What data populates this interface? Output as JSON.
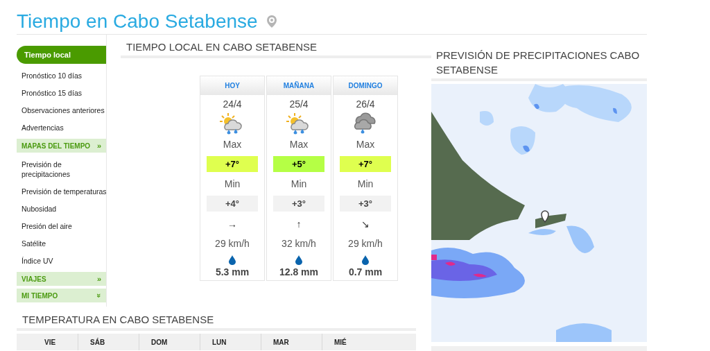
{
  "title": "Tiempo en Cabo Setabense",
  "sidebar": {
    "items": [
      {
        "kind": "link",
        "label": "Tiempo local",
        "selected": true
      },
      {
        "kind": "link",
        "label": "Pronóstico 10 días",
        "selected": false
      },
      {
        "kind": "link",
        "label": "Pronóstico 15 días",
        "selected": false
      },
      {
        "kind": "link",
        "label": "Observaciones anteriores",
        "selected": false
      },
      {
        "kind": "link",
        "label": "Advertencias",
        "selected": false
      },
      {
        "kind": "section",
        "label": "MAPAS DEL TIEMPO",
        "arrow": "»",
        "expanded": false
      },
      {
        "kind": "link",
        "label": "Previsión de precipitaciones",
        "selected": false
      },
      {
        "kind": "link",
        "label": "Previsión de temperaturas",
        "selected": false
      },
      {
        "kind": "link",
        "label": "Nubosidad",
        "selected": false
      },
      {
        "kind": "link",
        "label": "Presión del aire",
        "selected": false
      },
      {
        "kind": "link",
        "label": "Satélite",
        "selected": false
      },
      {
        "kind": "link",
        "label": "Índice UV",
        "selected": false
      },
      {
        "kind": "section",
        "label": "VIAJES",
        "arrow": "»",
        "expanded": false
      },
      {
        "kind": "section",
        "label": "MI TIEMPO",
        "arrow": "»",
        "expanded": true
      }
    ]
  },
  "forecast": {
    "heading": "TIEMPO LOCAL EN CABO SETABENSE",
    "days": [
      {
        "label": "HOY",
        "date": "24/4",
        "kind": "sun_cloud_rain",
        "max_label": "Max",
        "max": "+7°",
        "color": "#dfff4f",
        "min_label": "Min",
        "min": "+4°",
        "wind_arrow": "→",
        "wind": "29 km/h",
        "rain": "5.3 mm"
      },
      {
        "label": "MAÑANA",
        "date": "25/4",
        "kind": "sun_cloud_rain",
        "max_label": "Max",
        "max": "+5°",
        "color": "#b5ff45",
        "min_label": "Min",
        "min": "+3°",
        "wind_arrow": "↑",
        "wind": "32 km/h",
        "rain": "12.8 mm"
      },
      {
        "label": "DOMINGO",
        "date": "26/4",
        "kind": "cloud_rain",
        "max_label": "Max",
        "max": "+7°",
        "color": "#dfff4f",
        "min_label": "Min",
        "min": "+3°",
        "wind_arrow": "↘",
        "wind": "29 km/h",
        "rain": "0.7 mm"
      }
    ]
  },
  "temperature": {
    "heading": "TEMPERATURA EN CABO SETABENSE",
    "columns": [
      "VIE",
      "SÁB",
      "DOM",
      "LUN",
      "MAR",
      "MIÉ"
    ]
  },
  "precipitation": {
    "heading": "PREVISIÓN DE PRECIPITACIONES CABO SETABENSE"
  }
}
